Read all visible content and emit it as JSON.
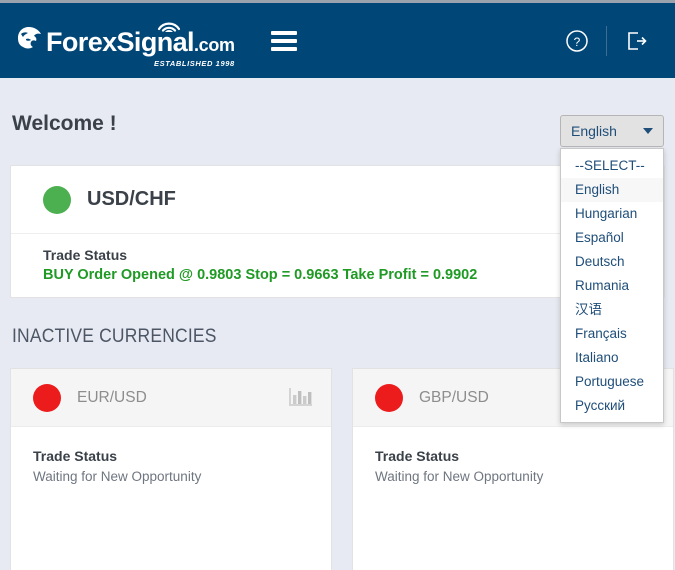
{
  "header": {
    "logo_main": "ForexSignal",
    "logo_dotcom": ".com",
    "logo_established": "ESTABLISHED 1998",
    "menu_icon": "hamburger-menu-icon",
    "help_icon": "help-circle-icon",
    "logout_icon": "logout-icon",
    "background_color": "#004677"
  },
  "page": {
    "welcome_text": "Welcome !",
    "section_title": "INACTIVE CURRENCIES",
    "background_color": "#e7eaf2"
  },
  "language_selector": {
    "selected": "English",
    "caret_icon": "chevron-down-icon",
    "options": [
      "--SELECT--",
      "English",
      "Hungarian",
      "Español",
      "Deutsch",
      "Rumania",
      "汉语",
      "Français",
      "Italiano",
      "Portuguese",
      "Русский"
    ]
  },
  "active_currency": {
    "status_color": "#4caf50",
    "pair": "USD/CHF",
    "trade_status_label": "Trade Status",
    "trade_status_value": "BUY Order Opened @ 0.9803 Stop = 0.9663 Take Profit = 0.9902",
    "value_color": "#1f9a24"
  },
  "inactive_currencies": [
    {
      "status_color": "#ed1c1c",
      "pair": "EUR/USD",
      "trade_status_label": "Trade Status",
      "trade_status_value": "Waiting for New Opportunity",
      "chart_icon": "bar-chart-icon"
    },
    {
      "status_color": "#ed1c1c",
      "pair": "GBP/USD",
      "trade_status_label": "Trade Status",
      "trade_status_value": "Waiting for New Opportunity",
      "chart_icon": "bar-chart-icon"
    }
  ]
}
